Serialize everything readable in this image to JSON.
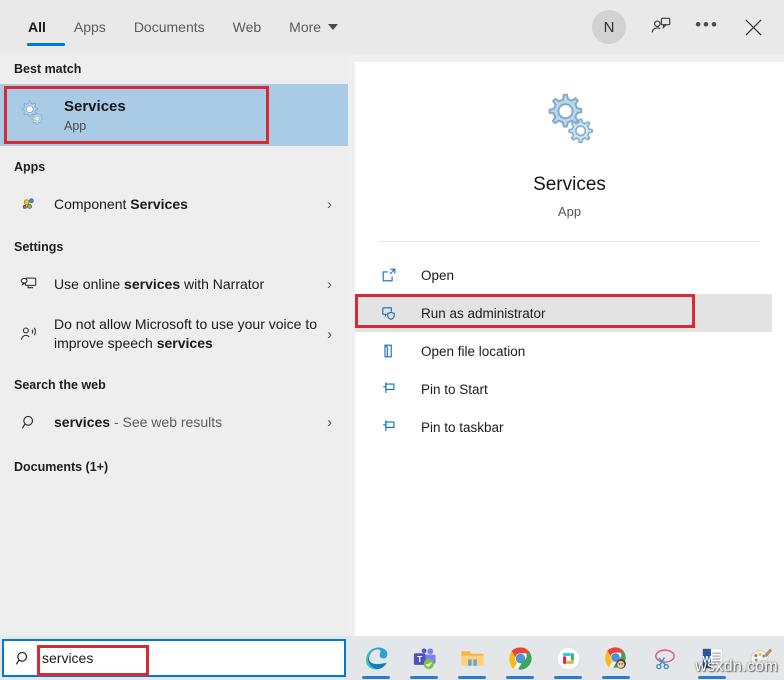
{
  "topbar": {
    "tabs": [
      {
        "label": "All",
        "active": true
      },
      {
        "label": "Apps",
        "active": false
      },
      {
        "label": "Documents",
        "active": false
      },
      {
        "label": "Web",
        "active": false
      },
      {
        "label": "More",
        "active": false,
        "has_caret": true
      }
    ],
    "avatar_initial": "N",
    "feedback_icon": "person-feedback-icon",
    "more_icon": "ellipsis-icon",
    "close_icon": "close-icon"
  },
  "left": {
    "best_match_header": "Best match",
    "best_match": {
      "title": "Services",
      "subtitle": "App",
      "icon": "gears-icon"
    },
    "apps_header": "Apps",
    "apps": [
      {
        "text_before": "Component ",
        "text_bold": "Services",
        "text_after": "",
        "icon": "component-services-icon"
      }
    ],
    "settings_header": "Settings",
    "settings": [
      {
        "text_before": "Use online ",
        "text_bold": "services",
        "text_after": " with Narrator",
        "icon": "narrator-icon"
      },
      {
        "text_before": "Do not allow Microsoft to use your voice to improve speech ",
        "text_bold": "services",
        "text_after": "",
        "icon": "voice-icon"
      }
    ],
    "web_header": "Search the web",
    "web": [
      {
        "text_before": "",
        "text_bold": "services",
        "text_after": " - See web results",
        "icon": "search-icon"
      }
    ],
    "documents_header": "Documents (1+)"
  },
  "preview": {
    "title": "Services",
    "subtitle": "App",
    "icon": "gears-icon",
    "actions": [
      {
        "label": "Open",
        "icon": "open-window-icon",
        "hovered": false
      },
      {
        "label": "Run as administrator",
        "icon": "shield-screen-icon",
        "hovered": true
      },
      {
        "label": "Open file location",
        "icon": "folder-location-icon",
        "hovered": false
      },
      {
        "label": "Pin to Start",
        "icon": "pin-icon",
        "hovered": false
      },
      {
        "label": "Pin to taskbar",
        "icon": "pin-icon",
        "hovered": false
      }
    ]
  },
  "taskbar": {
    "search_icon": "search-icon",
    "search_value": "services",
    "apps": [
      {
        "name": "microsoft-edge-icon",
        "running": true
      },
      {
        "name": "microsoft-teams-icon",
        "running": true
      },
      {
        "name": "file-explorer-icon",
        "running": true
      },
      {
        "name": "google-chrome-icon",
        "running": true
      },
      {
        "name": "slack-icon",
        "running": true
      },
      {
        "name": "chrome-profile-icon",
        "running": true
      },
      {
        "name": "snipping-tool-icon",
        "running": false
      },
      {
        "name": "microsoft-word-icon",
        "running": true
      },
      {
        "name": "paint-3d-icon",
        "running": false
      }
    ],
    "watermark": "wsxdn.com"
  },
  "colors": {
    "accent_blue": "#0078d4",
    "highlight_blue": "#a9cbe6",
    "annotation_red": "#d52b34",
    "hover_grey": "#e3e3e3"
  }
}
